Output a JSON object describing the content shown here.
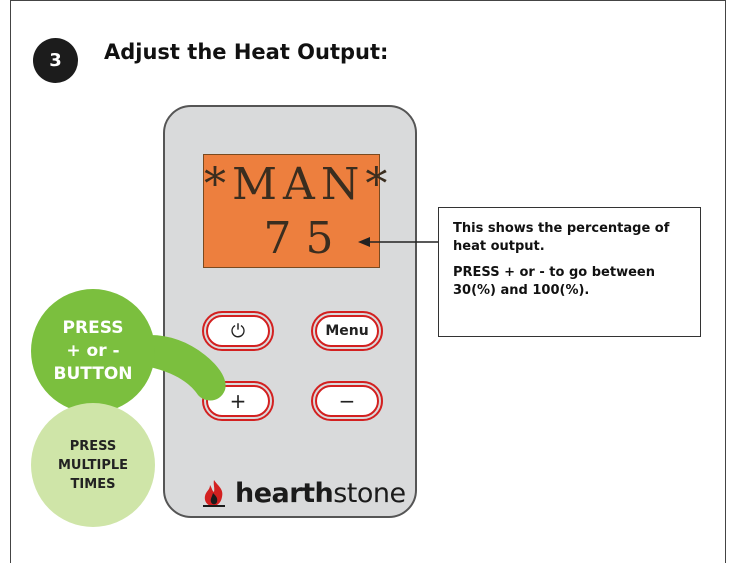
{
  "step": {
    "number": "3",
    "title": "Adjust the Heat Output:"
  },
  "display": {
    "line1": "*MAN*",
    "line2": "75"
  },
  "buttons": {
    "power_icon": "⏻",
    "menu_label": "Menu",
    "plus_label": "+",
    "minus_label": "−"
  },
  "brand": {
    "name_bold": "hearth",
    "name_light": "stone",
    "icon": "flame-icon"
  },
  "callout": {
    "text1": "This shows the percentage of heat output.",
    "text2": "PRESS + or - to go between 30(%) and 100(%)."
  },
  "press_bubble": {
    "line1": "PRESS",
    "line2": "+ or -",
    "line3": "BUTTON"
  },
  "multiple_bubble": {
    "line1": "PRESS",
    "line2": "MULTIPLE",
    "line3": "TIMES"
  },
  "colors": {
    "lcd": "#ed7f3e",
    "button_border": "#d32020",
    "green": "#7bbf3e",
    "light_green": "#cfe5a8",
    "panel": "#d9dadb"
  }
}
